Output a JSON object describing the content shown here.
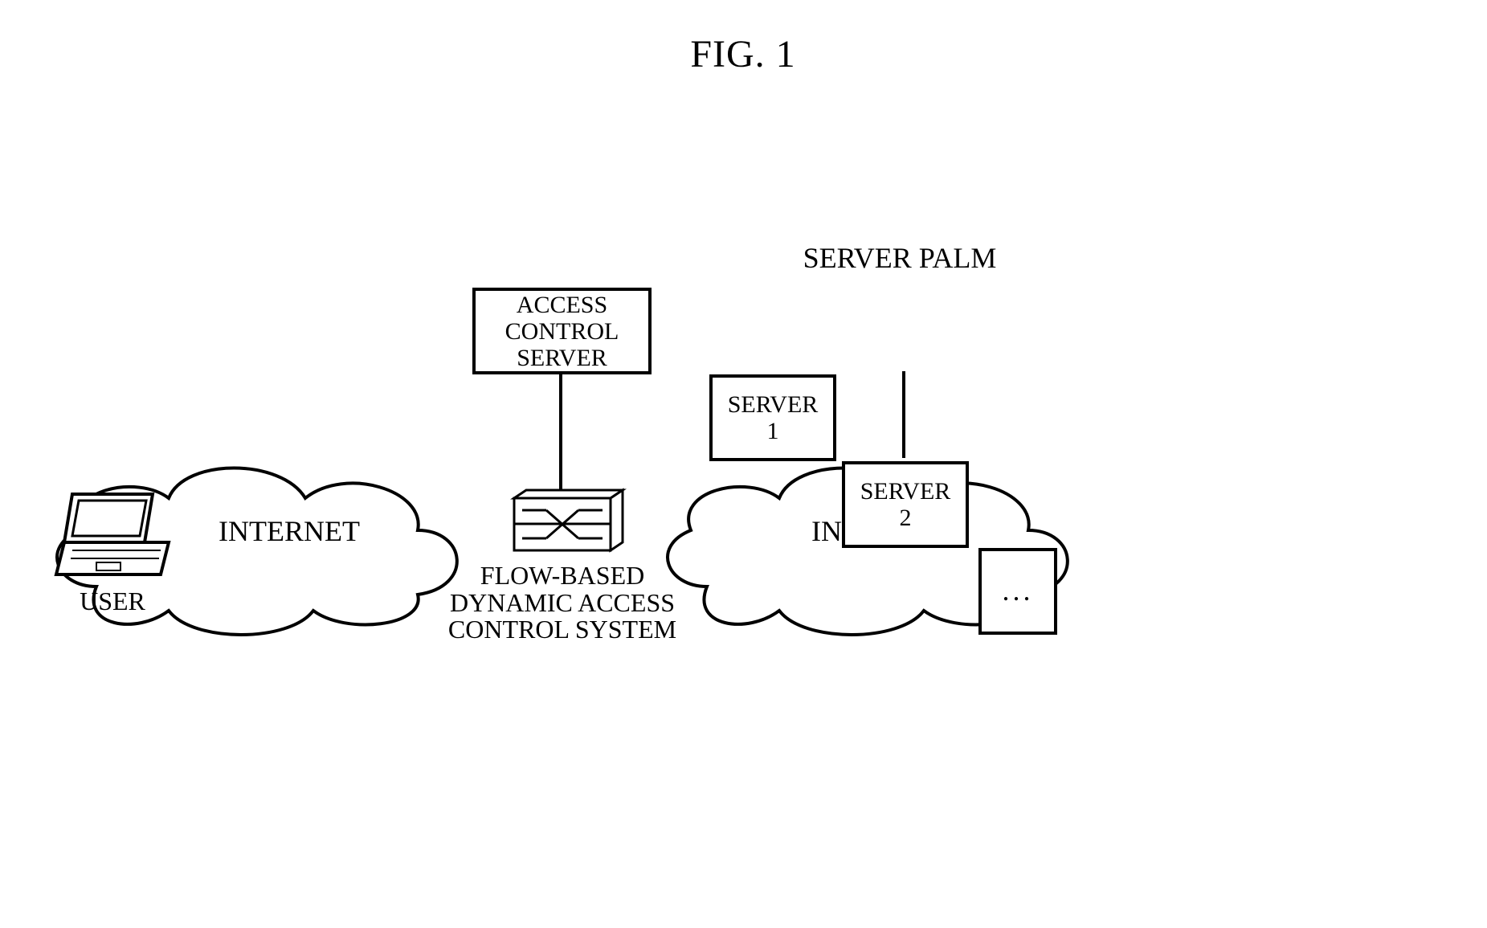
{
  "figure": {
    "title": "FIG. 1"
  },
  "user": {
    "label": "USER"
  },
  "cloud_left": {
    "label": "INTERNET"
  },
  "cloud_right": {
    "label": "INTRANET"
  },
  "switch": {
    "label_line1": "FLOW-BASED",
    "label_line2": "DYNAMIC ACCESS",
    "label_line3": "CONTROL SYSTEM"
  },
  "acs_box": {
    "line1": "ACCESS",
    "line2": "CONTROL",
    "line3": "SERVER"
  },
  "server_palm": {
    "title": "SERVER PALM",
    "servers": [
      {
        "line1": "SERVER",
        "line2": "1"
      },
      {
        "line1": "SERVER",
        "line2": "2"
      },
      {
        "line1": "...",
        "line2": ""
      }
    ]
  }
}
